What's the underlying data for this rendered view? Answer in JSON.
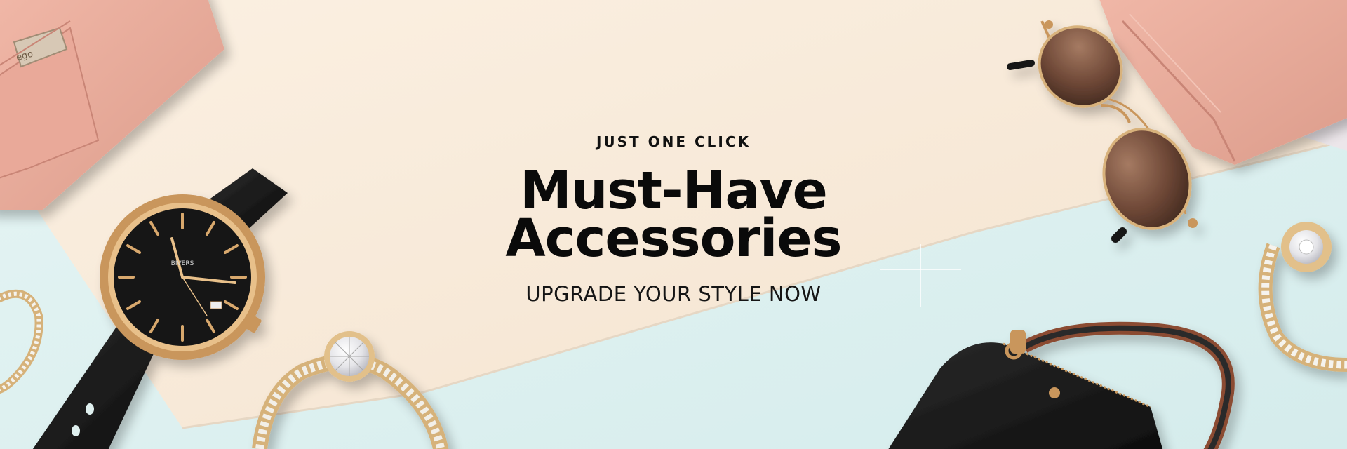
{
  "banner": {
    "eyebrow": "JUST ONE CLICK",
    "title_line1": "Must-Have",
    "title_line2": "Accessories",
    "subtitle": "UPGRADE YOUR STYLE NOW"
  },
  "products": {
    "watch_brand": "BIVERS",
    "wallet_logo": "ego"
  },
  "colors": {
    "cream": "#f8e9d7",
    "mint": "#dff0ef",
    "blush": "#e7a898",
    "black": "#111111",
    "gold": "#c9965b"
  },
  "icons": [
    "sparkle-icon",
    "watch-icon",
    "sunglasses-icon",
    "wallet-icon",
    "bracelet-icon",
    "handbag-icon"
  ]
}
